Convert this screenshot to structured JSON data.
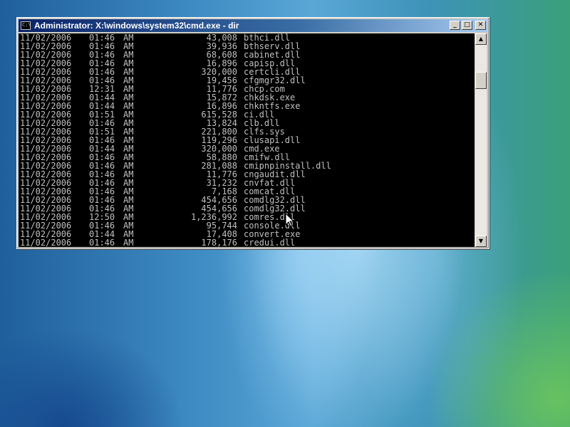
{
  "window": {
    "title": "Administrator: X:\\windows\\system32\\cmd.exe - dir",
    "icon_text": "C:\\",
    "buttons": {
      "minimize": "_",
      "maximize": "□",
      "close": "✕"
    }
  },
  "scrollbar": {
    "up_arrow": "▲",
    "down_arrow": "▼"
  },
  "listing": [
    {
      "date": "11/02/2006",
      "time": "01:46",
      "ampm": "AM",
      "size": "43,008",
      "name": "bthci.dll"
    },
    {
      "date": "11/02/2006",
      "time": "01:46",
      "ampm": "AM",
      "size": "39,936",
      "name": "bthserv.dll"
    },
    {
      "date": "11/02/2006",
      "time": "01:46",
      "ampm": "AM",
      "size": "68,608",
      "name": "cabinet.dll"
    },
    {
      "date": "11/02/2006",
      "time": "01:46",
      "ampm": "AM",
      "size": "16,896",
      "name": "capisp.dll"
    },
    {
      "date": "11/02/2006",
      "time": "01:46",
      "ampm": "AM",
      "size": "320,000",
      "name": "certcli.dll"
    },
    {
      "date": "11/02/2006",
      "time": "01:46",
      "ampm": "AM",
      "size": "19,456",
      "name": "cfgmgr32.dll"
    },
    {
      "date": "11/02/2006",
      "time": "12:31",
      "ampm": "AM",
      "size": "11,776",
      "name": "chcp.com"
    },
    {
      "date": "11/02/2006",
      "time": "01:44",
      "ampm": "AM",
      "size": "15,872",
      "name": "chkdsk.exe"
    },
    {
      "date": "11/02/2006",
      "time": "01:44",
      "ampm": "AM",
      "size": "16,896",
      "name": "chkntfs.exe"
    },
    {
      "date": "11/02/2006",
      "time": "01:51",
      "ampm": "AM",
      "size": "615,528",
      "name": "ci.dll"
    },
    {
      "date": "11/02/2006",
      "time": "01:46",
      "ampm": "AM",
      "size": "13,824",
      "name": "clb.dll"
    },
    {
      "date": "11/02/2006",
      "time": "01:51",
      "ampm": "AM",
      "size": "221,800",
      "name": "clfs.sys"
    },
    {
      "date": "11/02/2006",
      "time": "01:46",
      "ampm": "AM",
      "size": "119,296",
      "name": "clusapi.dll"
    },
    {
      "date": "11/02/2006",
      "time": "01:44",
      "ampm": "AM",
      "size": "320,000",
      "name": "cmd.exe"
    },
    {
      "date": "11/02/2006",
      "time": "01:46",
      "ampm": "AM",
      "size": "58,880",
      "name": "cmifw.dll"
    },
    {
      "date": "11/02/2006",
      "time": "01:46",
      "ampm": "AM",
      "size": "281,088",
      "name": "cmipnpinstall.dll"
    },
    {
      "date": "11/02/2006",
      "time": "01:46",
      "ampm": "AM",
      "size": "11,776",
      "name": "cngaudit.dll"
    },
    {
      "date": "11/02/2006",
      "time": "01:46",
      "ampm": "AM",
      "size": "31,232",
      "name": "cnvfat.dll"
    },
    {
      "date": "11/02/2006",
      "time": "01:46",
      "ampm": "AM",
      "size": "7,168",
      "name": "comcat.dll"
    },
    {
      "date": "11/02/2006",
      "time": "01:46",
      "ampm": "AM",
      "size": "454,656",
      "name": "comdlg32.dll"
    },
    {
      "date": "11/02/2006",
      "time": "01:46",
      "ampm": "AM",
      "size": "454,656",
      "name": "comdlg32.dll"
    },
    {
      "date": "11/02/2006",
      "time": "12:50",
      "ampm": "AM",
      "size": "1,236,992",
      "name": "comres.dll"
    },
    {
      "date": "11/02/2006",
      "time": "01:46",
      "ampm": "AM",
      "size": "95,744",
      "name": "console.dll"
    },
    {
      "date": "11/02/2006",
      "time": "01:44",
      "ampm": "AM",
      "size": "17,408",
      "name": "convert.exe"
    },
    {
      "date": "11/02/2006",
      "time": "01:46",
      "ampm": "AM",
      "size": "178,176",
      "name": "credui.dll"
    }
  ]
}
